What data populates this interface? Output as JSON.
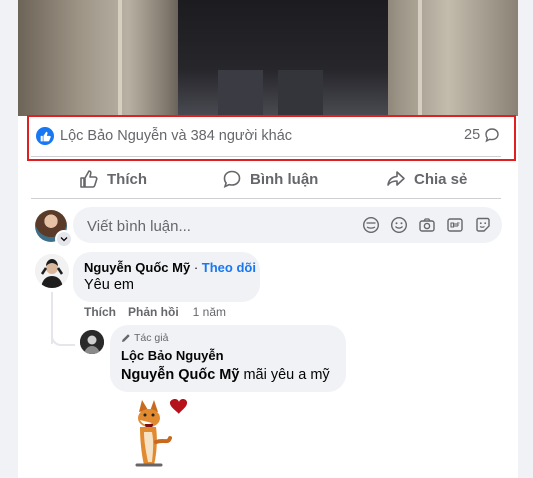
{
  "post": {
    "reactions_text": "Lộc Bảo Nguyễn và 384 người khác",
    "comments_count": "25"
  },
  "actions": {
    "like": "Thích",
    "comment": "Bình luận",
    "share": "Chia sẻ"
  },
  "composer": {
    "placeholder": "Viết bình luận..."
  },
  "comments": [
    {
      "author": "Nguyễn Quốc Mỹ",
      "separator": "·",
      "follow": "Theo dõi",
      "text": "Yêu em",
      "like": "Thích",
      "reply": "Phản hồi",
      "time": "1 năm"
    },
    {
      "badge": "Tác giả",
      "author": "Lộc Bảo Nguyễn",
      "tag": "Nguyễn Quốc Mỹ",
      "text": " mãi yêu a mỹ"
    }
  ],
  "colors": {
    "accent": "#1877f2",
    "highlight": "#e02020",
    "muted": "#65676b"
  }
}
